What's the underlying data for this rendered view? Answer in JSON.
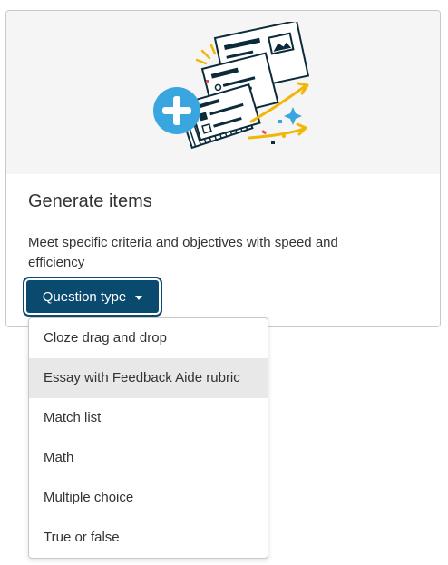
{
  "card": {
    "title": "Generate items",
    "description": "Meet specific criteria and objectives with speed and efficiency",
    "button_label": "Question type",
    "hero_icon": "generate-items-illustration"
  },
  "dropdown": {
    "options": [
      "Cloze drag and drop",
      "Essay with Feedback Aide rubric",
      "Match list",
      "Math",
      "Multiple choice",
      "True or false"
    ],
    "highlighted_index": 1
  },
  "colors": {
    "button_bg": "#0b4a6f",
    "plus_circle": "#3aa6e0",
    "accent_yellow": "#f2b705",
    "hero_bg": "#f5f5f5",
    "highlight_bg": "#e8e8e8"
  }
}
